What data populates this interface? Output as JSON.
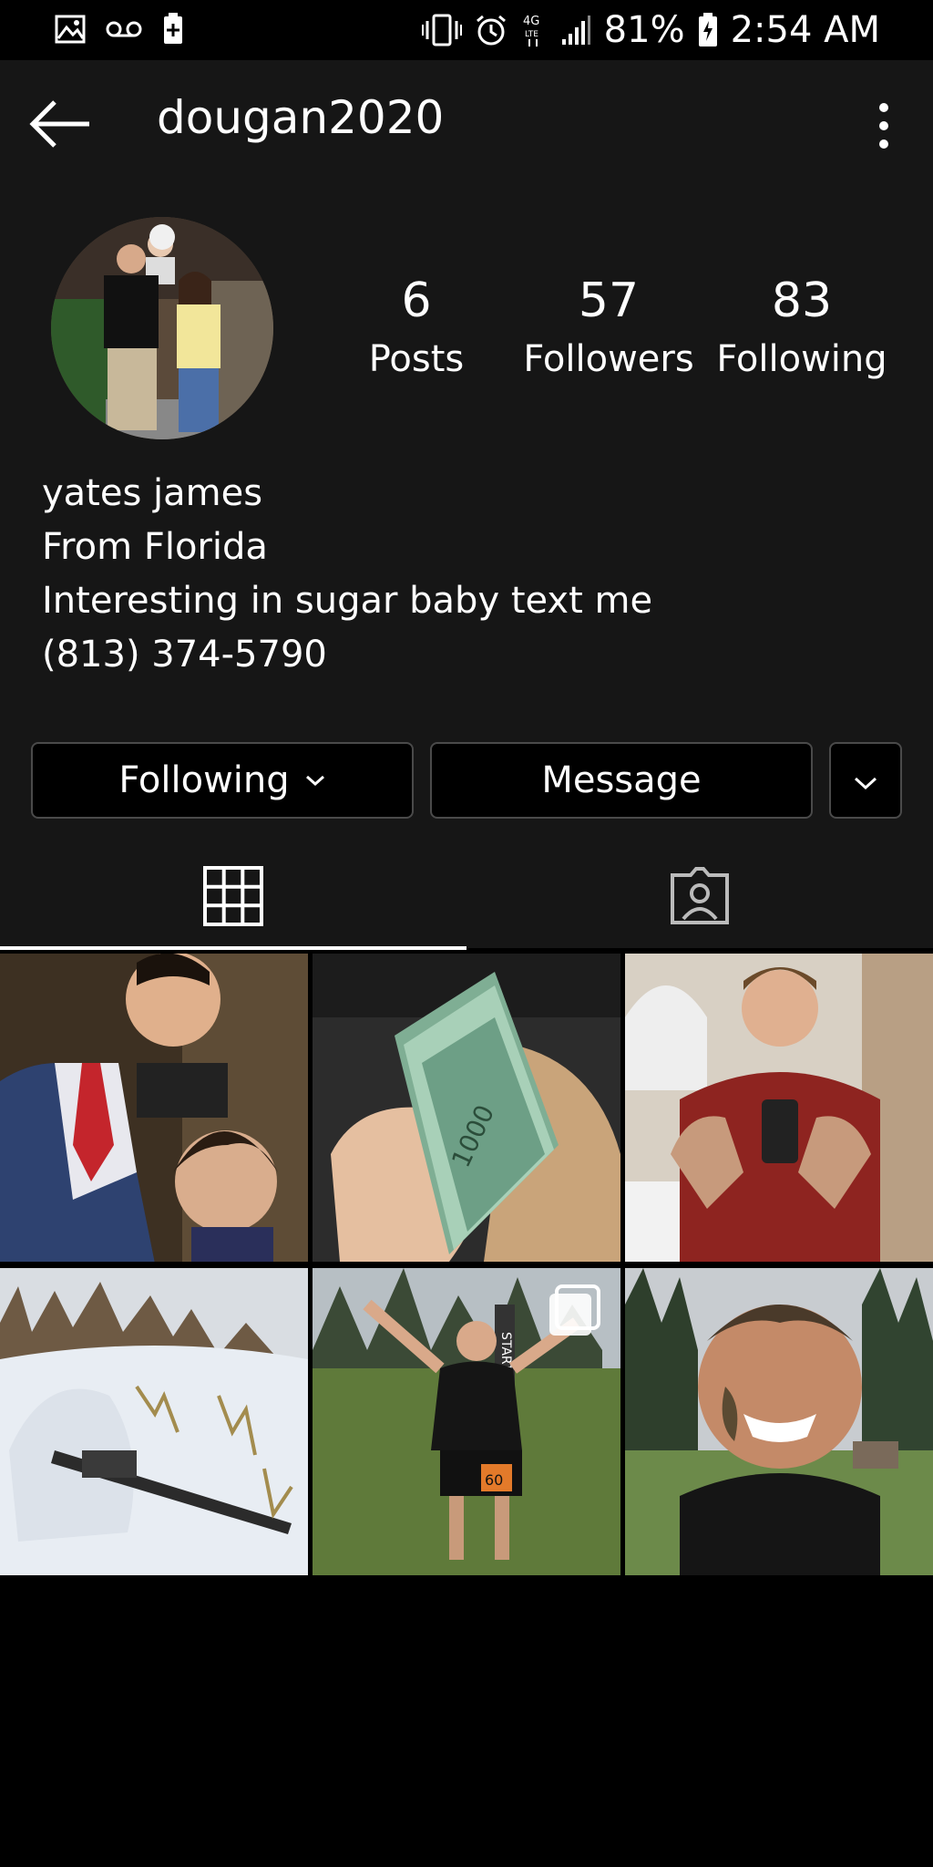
{
  "status_bar": {
    "battery": "81%",
    "time": "2:54 AM",
    "network": "4G LTE",
    "icons": [
      "gallery-icon",
      "voicemail-icon",
      "battery-plus-icon",
      "vibrate-icon",
      "alarm-icon",
      "signal-icon",
      "battery-icon"
    ]
  },
  "header": {
    "username": "dougan2020",
    "back_icon": "arrow-left-icon",
    "more_icon": "vertical-dots-icon"
  },
  "stats": [
    {
      "value": "6",
      "label": "Posts"
    },
    {
      "value": "57",
      "label": "Followers"
    },
    {
      "value": "83",
      "label": "Following"
    }
  ],
  "bio": {
    "name": "yates james",
    "line1": "From Florida",
    "line2": "Interesting in sugar baby text me",
    "phone": "(813) 374-5790"
  },
  "actions": {
    "following_label": "Following",
    "message_label": "Message"
  },
  "tabs": [
    {
      "icon": "grid-icon",
      "active": true
    },
    {
      "icon": "tagged-person-icon",
      "active": false
    }
  ],
  "posts": [
    {
      "description": "man in suit selfie with child"
    },
    {
      "description": "hand holding cash"
    },
    {
      "description": "man mirror selfie red shirt"
    },
    {
      "description": "soldier in snow camouflage with rifle"
    },
    {
      "description": "runner at race start"
    },
    {
      "description": "man with mud on face"
    }
  ],
  "photo_overlay": {
    "badge_text": "START",
    "bib_number": "60"
  },
  "colors": {
    "background": "#161616",
    "page": "#000000",
    "button_border": "#4a4a4a",
    "text": "#ffffff"
  }
}
